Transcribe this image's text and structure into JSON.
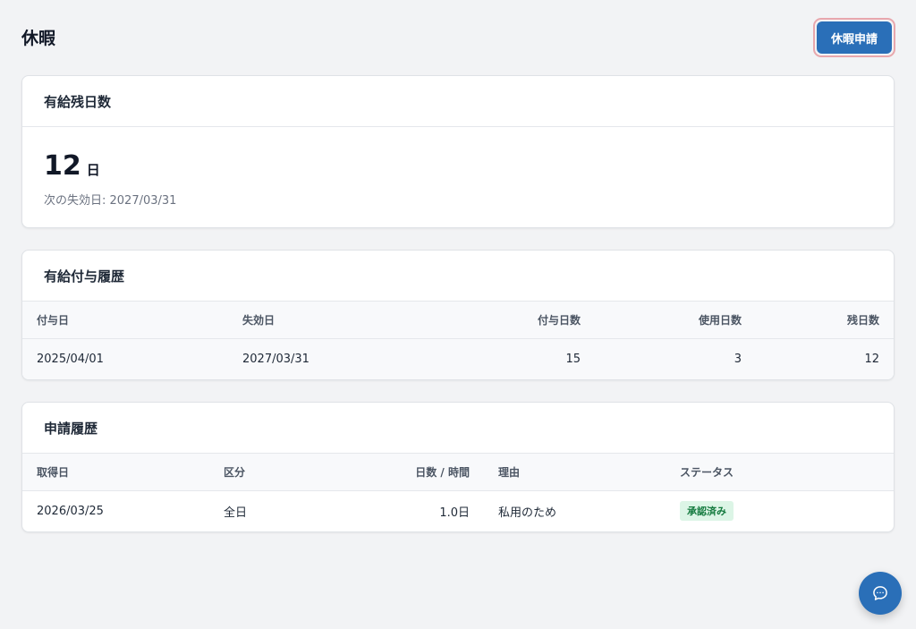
{
  "page": {
    "title": "休暇",
    "request_button": "休暇申請"
  },
  "balance": {
    "title": "有給残日数",
    "days": "12",
    "unit": "日",
    "expiry": "次の失効日: 2027/03/31"
  },
  "grant_history": {
    "title": "有給付与履歴",
    "columns": [
      "付与日",
      "失効日",
      "付与日数",
      "使用日数",
      "残日数"
    ],
    "rows": [
      {
        "grant_date": "2025/04/01",
        "expiry_date": "2027/03/31",
        "granted": "15",
        "used": "3",
        "remaining": "12"
      }
    ]
  },
  "request_history": {
    "title": "申請履歴",
    "columns": [
      "取得日",
      "区分",
      "日数 / 時間",
      "理由",
      "ステータス"
    ],
    "rows": [
      {
        "date": "2026/03/25",
        "type": "全日",
        "amount": "1.0日",
        "reason": "私用のため",
        "status": "承認済み"
      }
    ]
  },
  "icons": {
    "chat": "chat-bubble-icon"
  },
  "colors": {
    "primary": "#2a6fb8",
    "status_approved_bg": "#dcf5e6",
    "status_approved_text": "#137a3e"
  }
}
